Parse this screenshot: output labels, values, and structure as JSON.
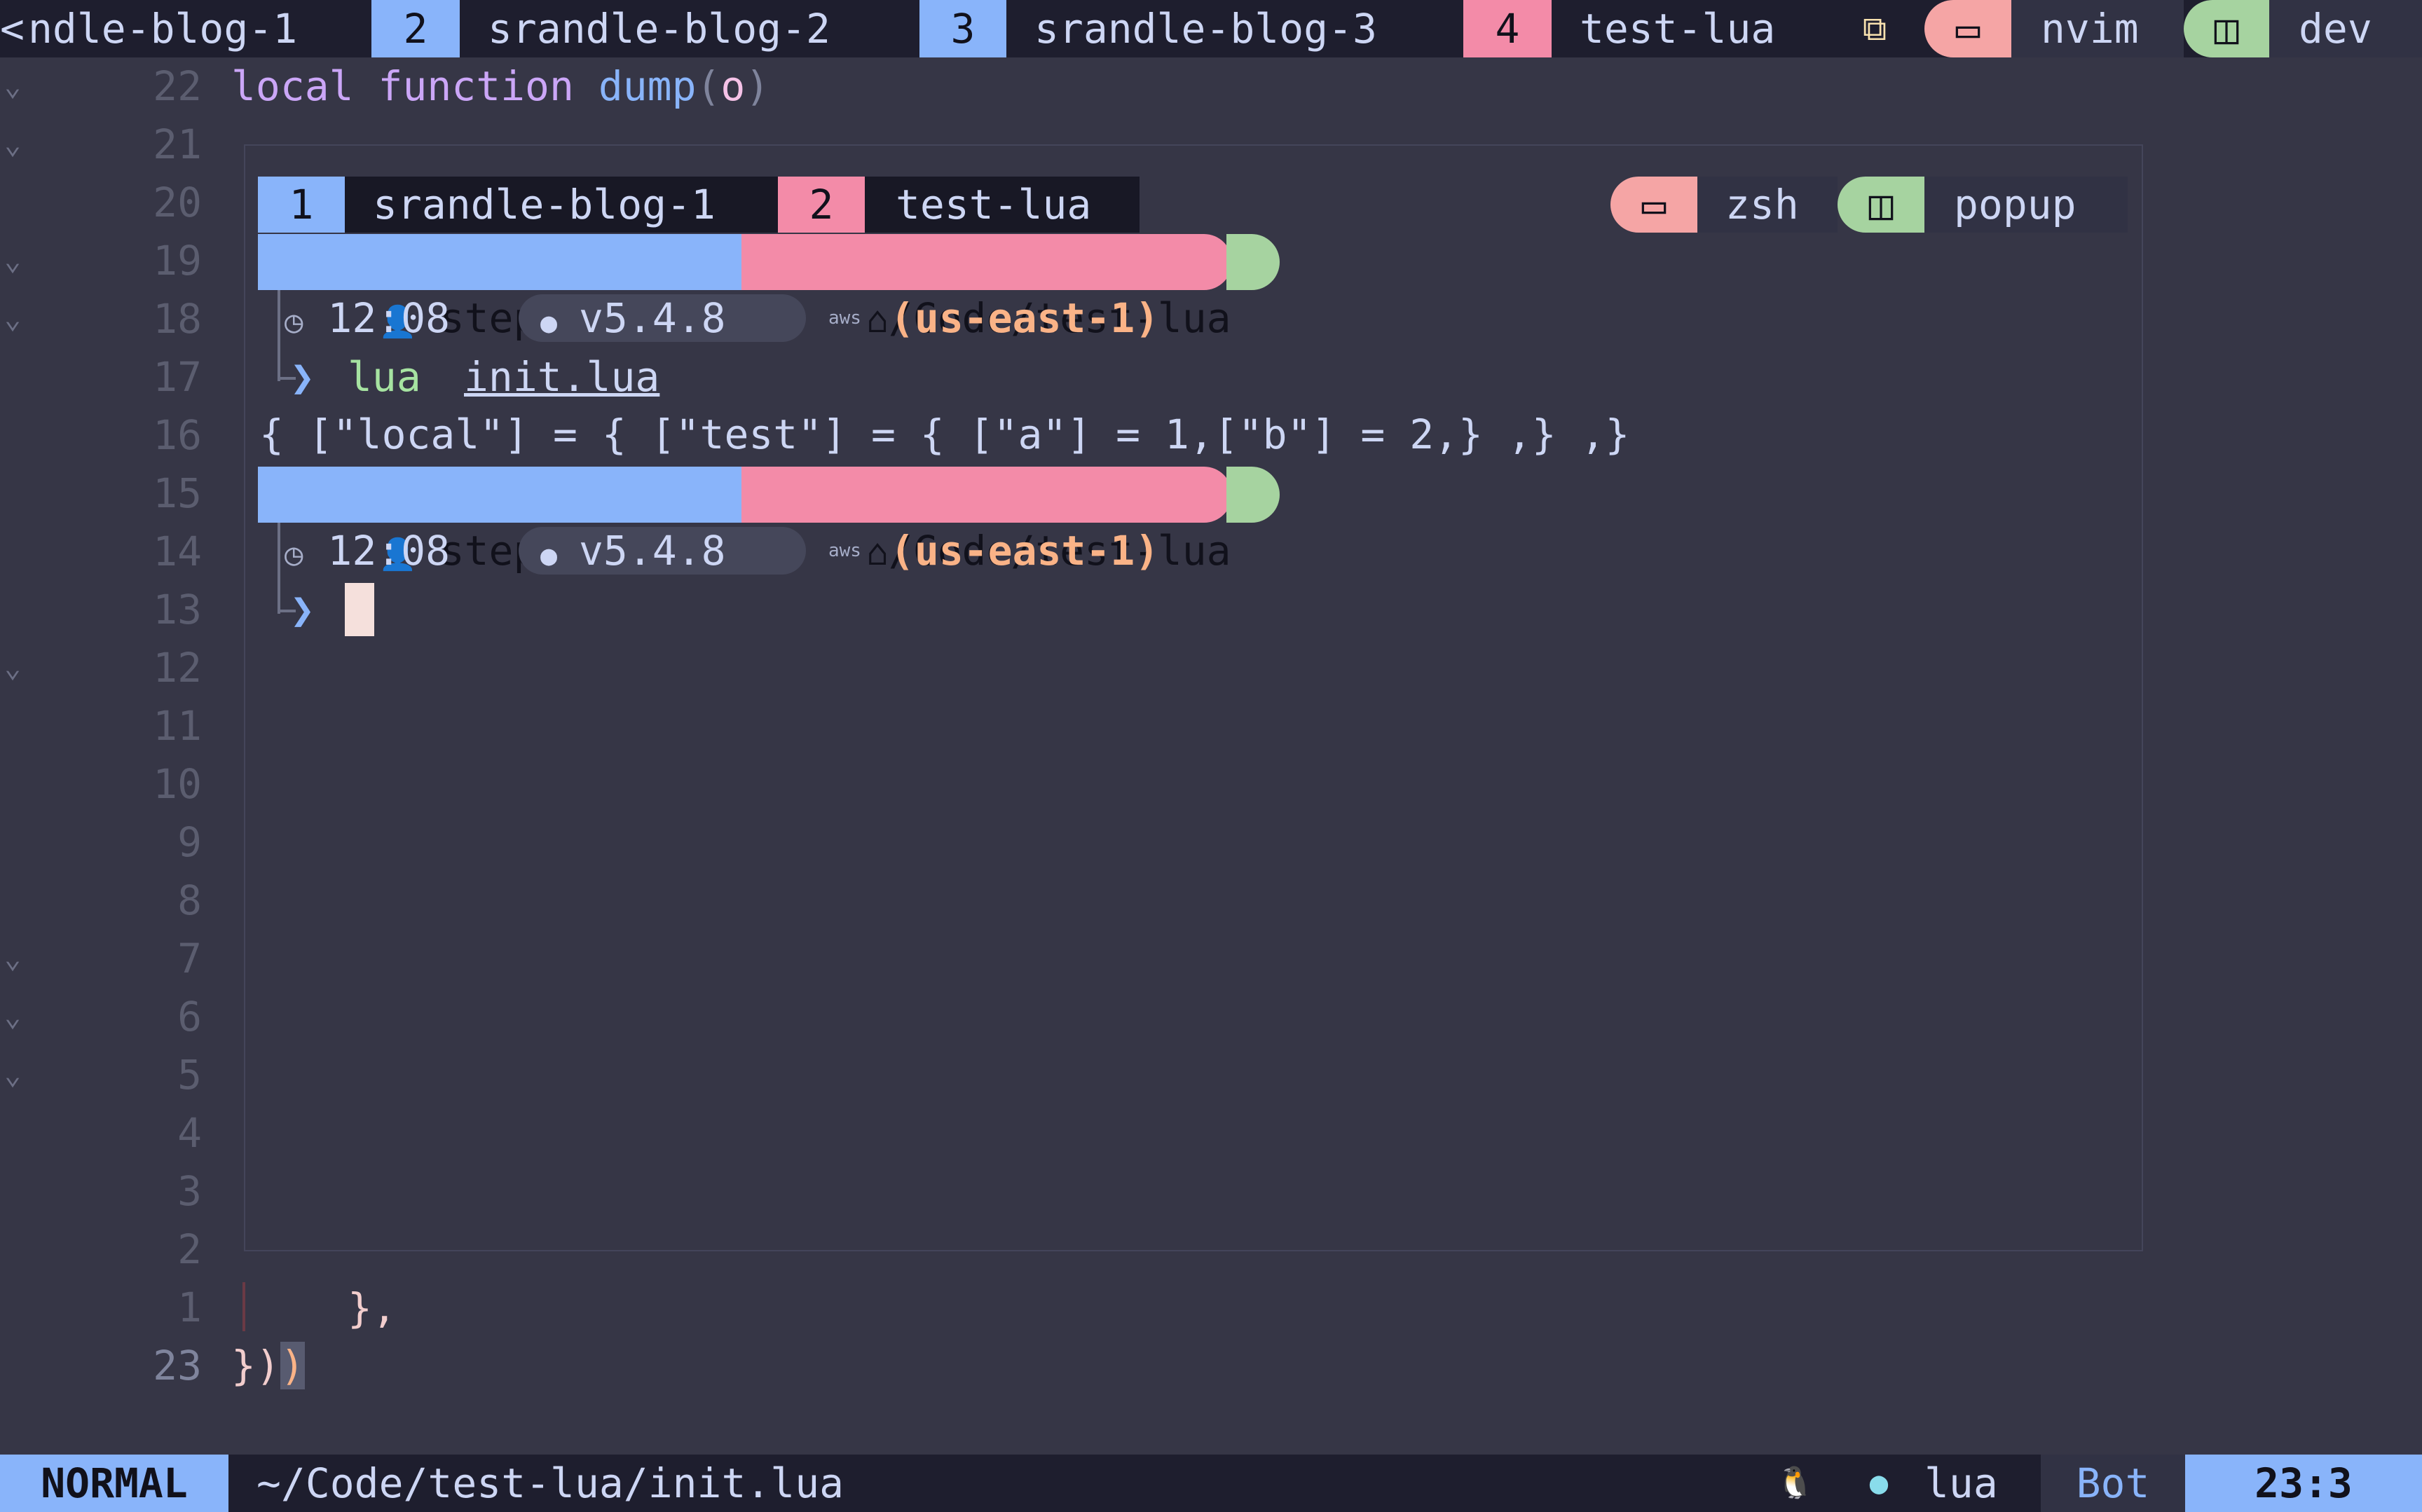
{
  "tmux_top": {
    "overflow": "<",
    "tabs": [
      {
        "num": "",
        "name": "ndle-blog-1"
      },
      {
        "num": "2",
        "name": "srandle-blog-2"
      },
      {
        "num": "3",
        "name": "srandle-blog-3"
      },
      {
        "num": "4",
        "name": "test-lua"
      }
    ],
    "zoom_glyph": "⧉",
    "pane_icon": "▭",
    "pane_name": "nvim",
    "layout_icon": "◫",
    "session_name": "dev"
  },
  "editor": {
    "code_line_22": {
      "kw1": "local",
      "kw2": "function",
      "fn": "dump",
      "paren_open": "(",
      "arg": "o",
      "paren_close": ")"
    },
    "relative_numbers_above": [
      "22",
      "21",
      "20",
      "19",
      "18",
      "17",
      "16",
      "15",
      "14",
      "13",
      "12",
      "11",
      "10",
      "9",
      "8",
      "7",
      "6",
      "5",
      "4",
      "3",
      "2",
      "1"
    ],
    "current_line_number": "23",
    "line_1_text": "},",
    "line_23_text_a": "})",
    "line_23_text_b": ")",
    "fold_markers": [
      "⌄",
      "⌄",
      "⌄",
      "⌄",
      "⌄",
      "⌄",
      "⌄",
      "⌄"
    ]
  },
  "popup": {
    "tabs": [
      {
        "num": "1",
        "name": "srandle-blog-1"
      },
      {
        "num": "2",
        "name": "test-lua"
      }
    ],
    "pane_icon": "▭",
    "pane_name": "zsh",
    "layout_icon": "◫",
    "session_name": "popup",
    "prompt": {
      "user_icon": "👤",
      "user": "stephanrandle",
      "home_icon": "⌂",
      "path": "/Code/test-lua",
      "clock_icon": "◷",
      "time": "12:08",
      "lua_icon": "●",
      "lua_version": "v5.4.8",
      "aws_label": "aws",
      "aws_region": "(us-east-1)",
      "chevron": "❯"
    },
    "command": {
      "bin": "lua",
      "arg": "init.lua"
    },
    "output": "{ [\"local\"] = { [\"test\"] = { [\"a\"] = 1,[\"b\"] = 2,} ,} ,}"
  },
  "statusline": {
    "mode": "NORMAL",
    "file": "~/Code/test-lua/init.lua",
    "os_icon": "🐧",
    "ft_icon": "●",
    "filetype": "lua",
    "position_label": "Bot",
    "cursor_pos": "23:3"
  },
  "colors": {
    "bg": "#363646",
    "accent_blue": "#89b4fa",
    "accent_pink": "#f38ba8",
    "accent_green": "#a6d3a0",
    "accent_peach": "#fab387"
  }
}
